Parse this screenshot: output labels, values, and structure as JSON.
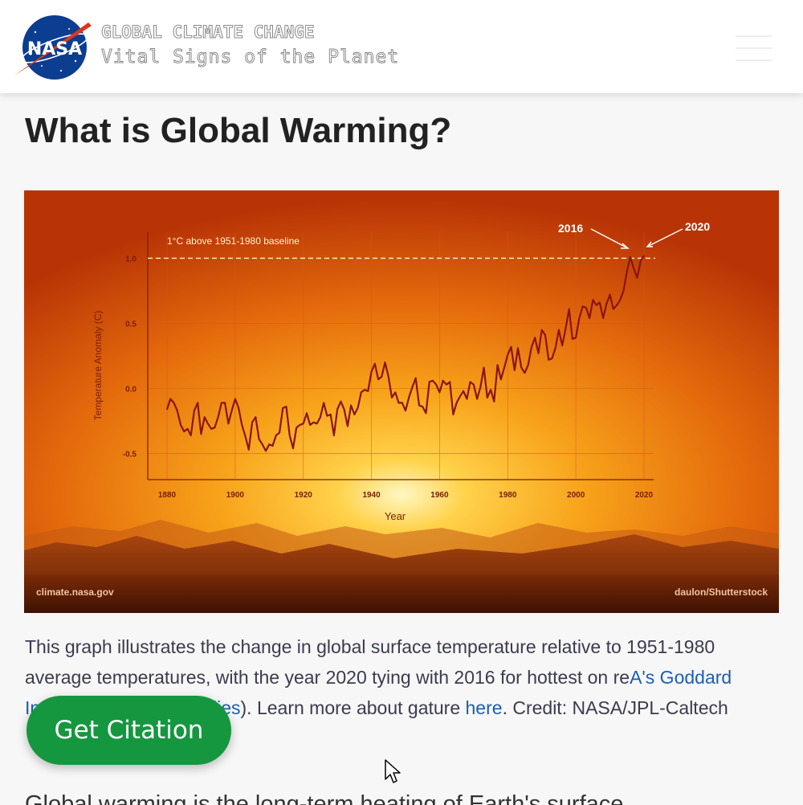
{
  "header": {
    "logo": "nasa-meatball-logo",
    "logo_text": "NASA",
    "site_title": "GLOBAL CLIMATE CHANGE",
    "site_subtitle": "Vital Signs of the Planet",
    "menu_icon": "hamburger-menu-icon"
  },
  "main": {
    "page_title": "What is Global Warming?",
    "caption": {
      "part1": "This graph illustrates the change in global surface temperature relative to 1951-1980 average temperatures, with the year 2020 tying with 2016 for hottest on re",
      "link1": "A's Goddard Institute for Space Studies",
      "part2": "). Learn more about g",
      "part3": "ature ",
      "link2": "here",
      "part4": ". Credit: NASA/JPL-Caltech"
    },
    "citation_button": "Get Citation",
    "next_paragraph": "Global warming is the long-term heating of Earth's surface"
  },
  "figure": {
    "source_left": "climate.nasa.gov",
    "source_right": "daulon/Shutterstock",
    "baseline_label": "1°C above 1951-1980 baseline",
    "annotation_2016": "2016",
    "annotation_2020": "2020"
  },
  "chart_data": {
    "type": "line",
    "title": "",
    "xlabel": "Year",
    "ylabel": "Temperature Anomaly (C)",
    "xlim": [
      1880,
      2020
    ],
    "ylim": [
      -0.7,
      1.2
    ],
    "xticks": [
      1880,
      1900,
      1920,
      1940,
      1960,
      1980,
      2000,
      2020
    ],
    "yticks": [
      -0.5,
      0.0,
      0.5,
      1.0
    ],
    "ytick_labels": [
      "-0.5",
      "0.0",
      "0.5",
      "1.0"
    ],
    "baseline_value": 1.0,
    "line_color": "#8a1414",
    "x": [
      1880,
      1881,
      1882,
      1883,
      1884,
      1885,
      1886,
      1887,
      1888,
      1889,
      1890,
      1891,
      1892,
      1893,
      1894,
      1895,
      1896,
      1897,
      1898,
      1899,
      1900,
      1901,
      1902,
      1903,
      1904,
      1905,
      1906,
      1907,
      1908,
      1909,
      1910,
      1911,
      1912,
      1913,
      1914,
      1915,
      1916,
      1917,
      1918,
      1919,
      1920,
      1921,
      1922,
      1923,
      1924,
      1925,
      1926,
      1927,
      1928,
      1929,
      1930,
      1931,
      1932,
      1933,
      1934,
      1935,
      1936,
      1937,
      1938,
      1939,
      1940,
      1941,
      1942,
      1943,
      1944,
      1945,
      1946,
      1947,
      1948,
      1949,
      1950,
      1951,
      1952,
      1953,
      1954,
      1955,
      1956,
      1957,
      1958,
      1959,
      1960,
      1961,
      1962,
      1963,
      1964,
      1965,
      1966,
      1967,
      1968,
      1969,
      1970,
      1971,
      1972,
      1973,
      1974,
      1975,
      1976,
      1977,
      1978,
      1979,
      1980,
      1981,
      1982,
      1983,
      1984,
      1985,
      1986,
      1987,
      1988,
      1989,
      1990,
      1991,
      1992,
      1993,
      1994,
      1995,
      1996,
      1997,
      1998,
      1999,
      2000,
      2001,
      2002,
      2003,
      2004,
      2005,
      2006,
      2007,
      2008,
      2009,
      2010,
      2011,
      2012,
      2013,
      2014,
      2015,
      2016,
      2017,
      2018,
      2019,
      2020
    ],
    "y": [
      -0.16,
      -0.08,
      -0.11,
      -0.17,
      -0.28,
      -0.33,
      -0.31,
      -0.36,
      -0.17,
      -0.11,
      -0.35,
      -0.22,
      -0.27,
      -0.31,
      -0.3,
      -0.22,
      -0.11,
      -0.11,
      -0.27,
      -0.17,
      -0.08,
      -0.15,
      -0.28,
      -0.37,
      -0.47,
      -0.26,
      -0.22,
      -0.39,
      -0.43,
      -0.48,
      -0.43,
      -0.44,
      -0.36,
      -0.34,
      -0.15,
      -0.14,
      -0.36,
      -0.46,
      -0.3,
      -0.28,
      -0.27,
      -0.19,
      -0.28,
      -0.26,
      -0.27,
      -0.22,
      -0.11,
      -0.21,
      -0.2,
      -0.36,
      -0.16,
      -0.1,
      -0.16,
      -0.29,
      -0.13,
      -0.2,
      -0.15,
      -0.03,
      -0.01,
      -0.02,
      0.13,
      0.19,
      0.07,
      0.09,
      0.2,
      0.09,
      -0.07,
      -0.03,
      -0.11,
      -0.11,
      -0.17,
      -0.07,
      0.01,
      0.08,
      -0.13,
      -0.14,
      -0.19,
      0.05,
      0.06,
      0.03,
      -0.03,
      0.06,
      0.03,
      0.05,
      -0.2,
      -0.11,
      -0.06,
      -0.02,
      -0.08,
      0.05,
      0.03,
      -0.08,
      0.01,
      0.16,
      -0.07,
      -0.01,
      -0.1,
      0.18,
      0.07,
      0.16,
      0.26,
      0.32,
      0.14,
      0.31,
      0.16,
      0.12,
      0.18,
      0.32,
      0.39,
      0.27,
      0.45,
      0.41,
      0.22,
      0.23,
      0.31,
      0.45,
      0.33,
      0.46,
      0.61,
      0.38,
      0.39,
      0.54,
      0.63,
      0.62,
      0.54,
      0.68,
      0.64,
      0.66,
      0.54,
      0.65,
      0.72,
      0.61,
      0.64,
      0.68,
      0.75,
      0.9,
      1.01,
      0.92,
      0.85,
      0.98,
      1.02
    ]
  }
}
